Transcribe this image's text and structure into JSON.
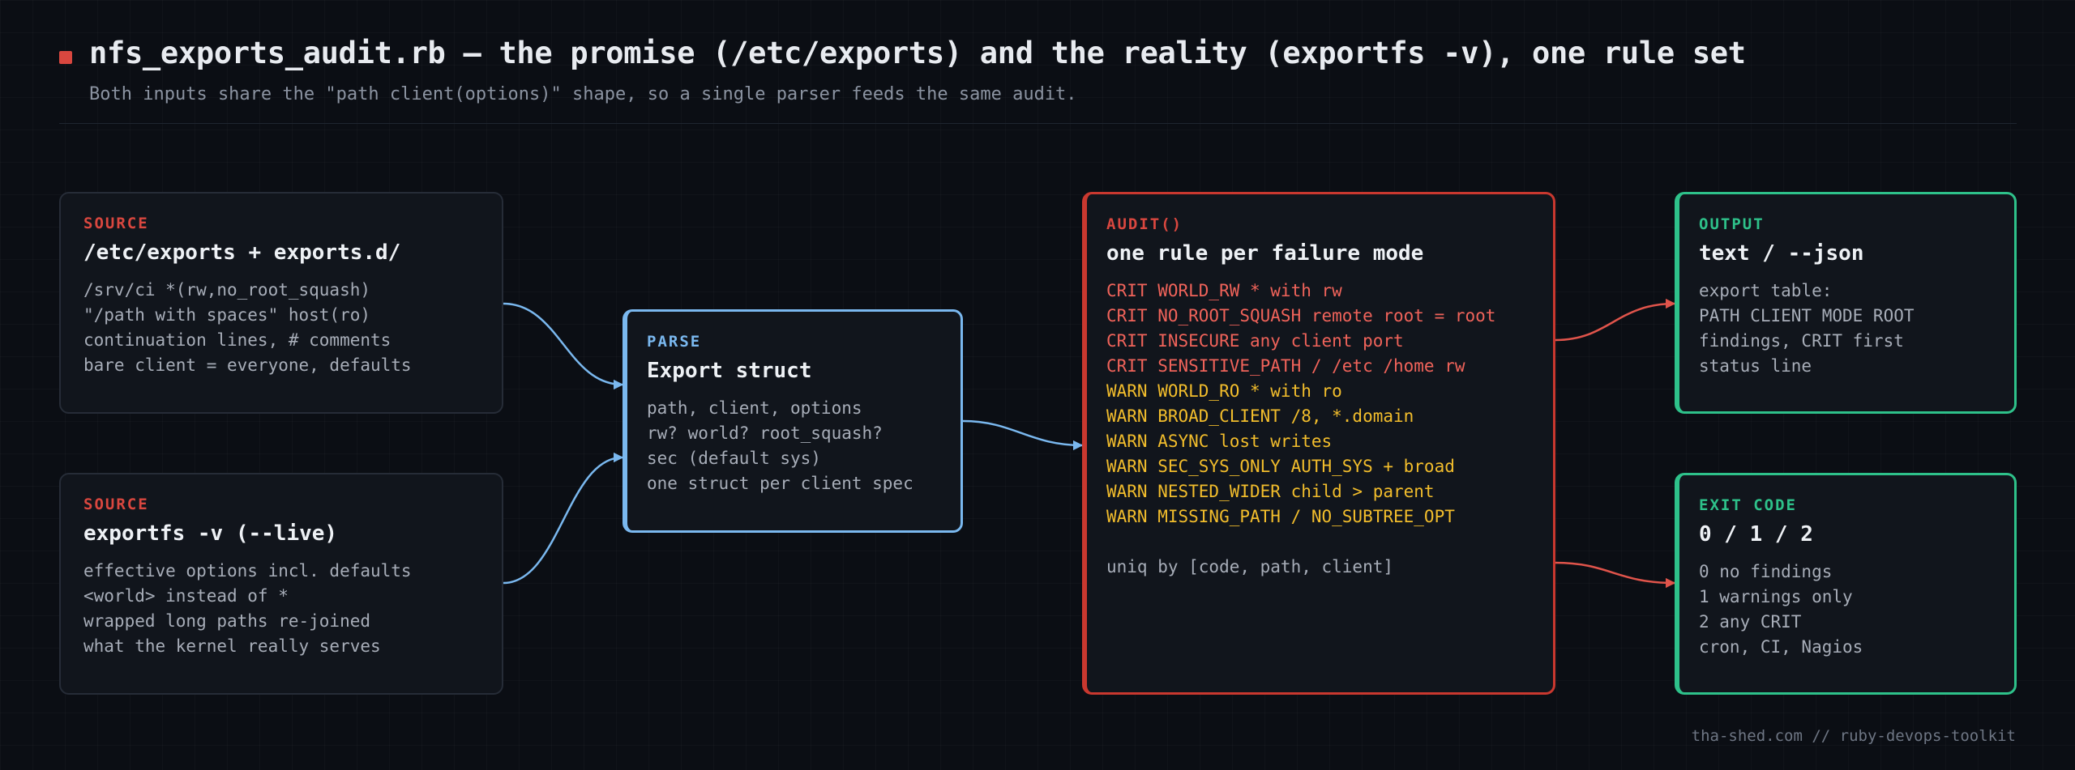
{
  "header": {
    "title": "nfs_exports_audit.rb — the promise (/etc/exports) and the reality (exportfs -v), one rule set",
    "subtitle": "Both inputs share the \"path client(options)\" shape, so a single parser feeds the same audit."
  },
  "source_exports": {
    "tag": "SOURCE",
    "heading": "/etc/exports + exports.d/",
    "lines": [
      "/srv/ci *(rw,no_root_squash)",
      "\"/path with spaces\" host(ro)",
      "continuation lines, # comments",
      "bare client = everyone, defaults"
    ]
  },
  "source_live": {
    "tag": "SOURCE",
    "heading": "exportfs -v (--live)",
    "lines": [
      "effective options incl. defaults",
      "<world> instead of *",
      "wrapped long paths re-joined",
      "what the kernel really serves"
    ]
  },
  "parse": {
    "tag": "PARSE",
    "heading": "Export struct",
    "lines": [
      "path, client, options",
      "rw? world? root_squash?",
      "sec (default sys)",
      "one struct per client spec"
    ]
  },
  "audit": {
    "tag": "AUDIT()",
    "heading": "one rule per failure mode",
    "crit_rules": [
      "CRIT WORLD_RW * with rw",
      "CRIT NO_ROOT_SQUASH remote root = root",
      "CRIT INSECURE any client port",
      "CRIT SENSITIVE_PATH / /etc /home rw"
    ],
    "warn_rules": [
      "WARN WORLD_RO * with ro",
      "WARN BROAD_CLIENT /8, *.domain",
      "WARN ASYNC lost writes",
      "WARN SEC_SYS_ONLY AUTH_SYS + broad",
      "WARN NESTED_WIDER child > parent",
      "WARN MISSING_PATH / NO_SUBTREE_OPT"
    ],
    "footer": "uniq by [code, path, client]"
  },
  "output": {
    "tag": "OUTPUT",
    "heading": "text / --json",
    "lines": [
      "export table:",
      "PATH CLIENT MODE ROOT",
      "findings, CRIT first",
      "status line"
    ]
  },
  "exit_code": {
    "tag": "EXIT CODE",
    "heading": "0 / 1 / 2",
    "lines": [
      "0 no findings",
      "1 warnings only",
      "2 any CRIT",
      "cron, CI, Nagios"
    ]
  },
  "footer": "tha-shed.com // ruby-devops-toolkit",
  "colors": {
    "background": "#0b0e14",
    "source_accent": "#d9473f",
    "parse_accent": "#7ab8ef",
    "audit_accent": "#c9382f",
    "output_accent": "#2ec18a",
    "crit_text": "#f0635a",
    "warn_text": "#f2bd2c"
  }
}
